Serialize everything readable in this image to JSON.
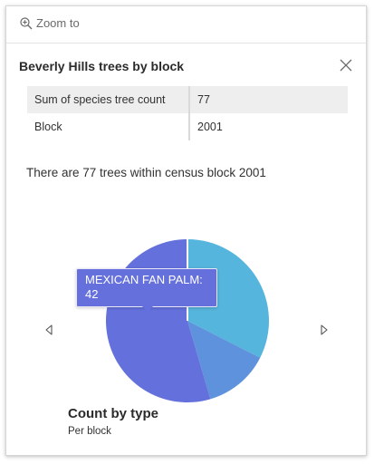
{
  "toolbar": {
    "zoom_label": "Zoom to"
  },
  "popup": {
    "title": "Beverly Hills trees by block"
  },
  "fields": [
    {
      "key": "Sum of species tree count",
      "value": "77"
    },
    {
      "key": "Block",
      "value": "2001"
    }
  ],
  "description": "There are 77 trees within census block 2001",
  "tooltip": {
    "line1": "MEXICAN FAN PALM:",
    "line2": "42"
  },
  "chart": {
    "title": "Count by type",
    "subtitle": "Per block"
  },
  "colors": {
    "slice_1": "#56b5dc",
    "slice_2": "#5e92dc",
    "slice_3": "#6470dc"
  },
  "chart_data": {
    "type": "pie",
    "title": "Count by type",
    "subtitle": "Per block",
    "total": 77,
    "slices": [
      {
        "value": 25,
        "color": "#56b5dc"
      },
      {
        "value": 10,
        "color": "#5e92dc"
      },
      {
        "label": "MEXICAN FAN PALM",
        "value": 42,
        "color": "#6470dc"
      }
    ]
  }
}
